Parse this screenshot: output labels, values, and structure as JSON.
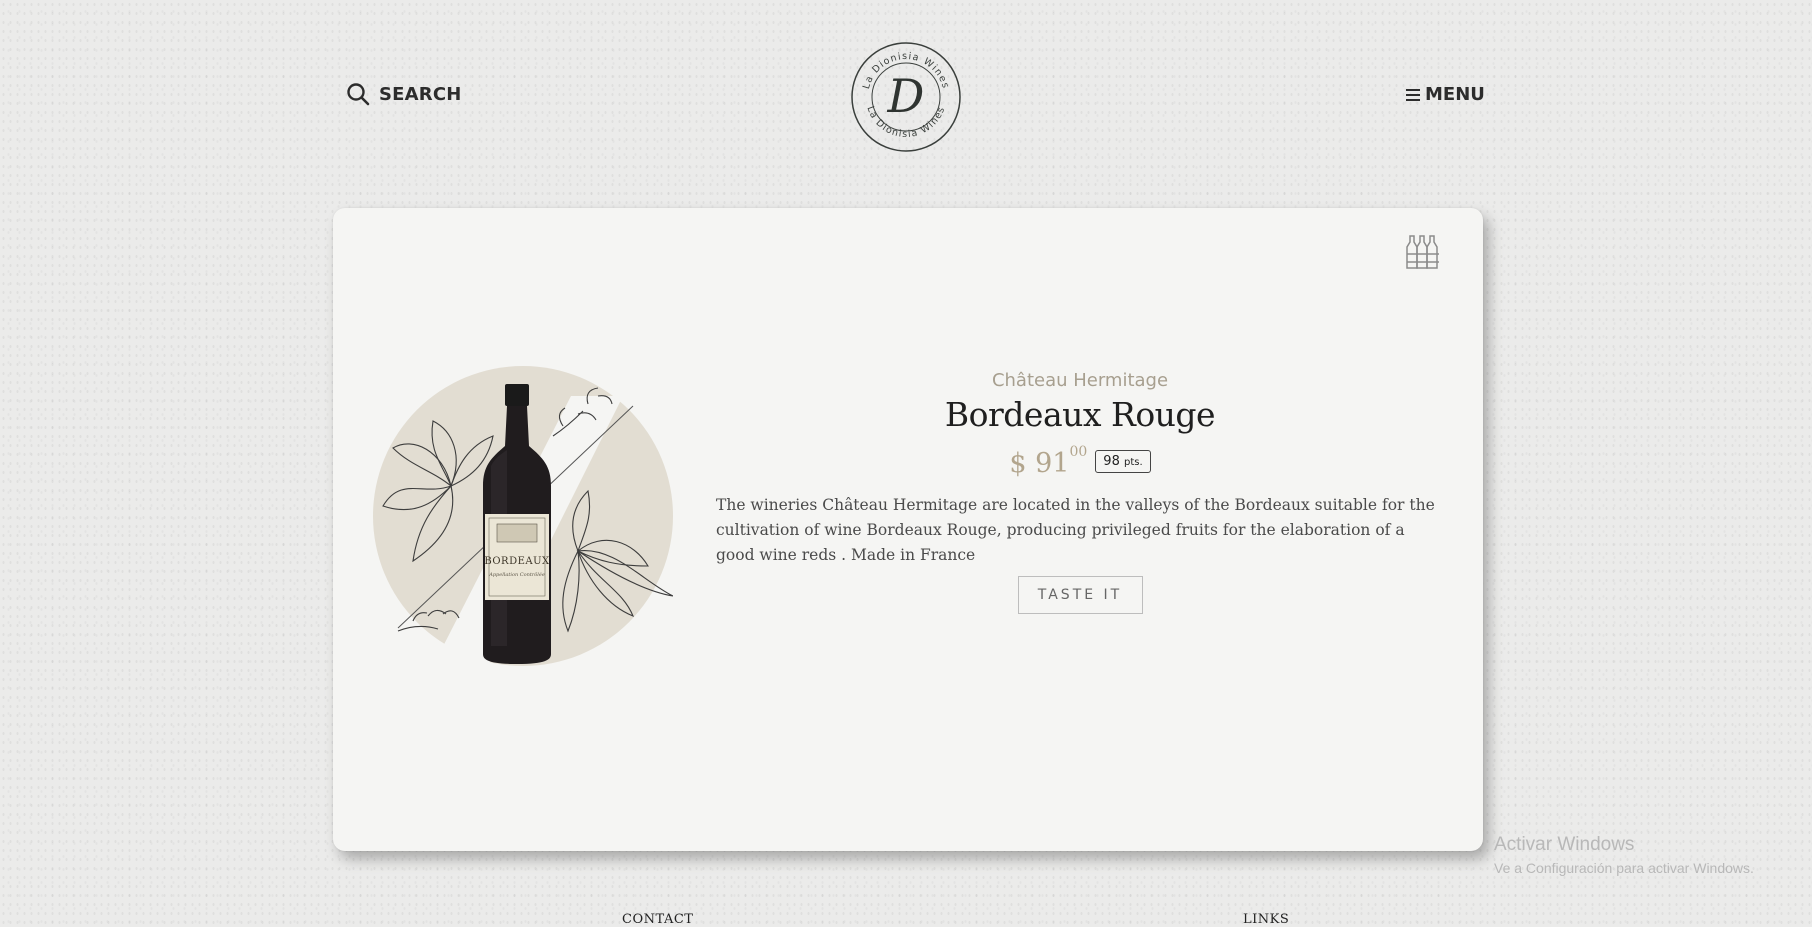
{
  "header": {
    "search_label": "SEARCH",
    "menu_label": "MENU",
    "logo_initial": "D",
    "logo_ring_text": "La Dionisia Wines"
  },
  "product": {
    "winery": "Château Hermitage",
    "name": "Bordeaux Rouge",
    "price_currency": "$",
    "price_whole": "91",
    "price_cents": "00",
    "points": "98",
    "points_unit": "pts.",
    "description": "The wineries Château Hermitage are located in the valleys of the Bordeaux suitable for the cultivation of wine Bordeaux Rouge, producing privileged fruits for the elaboration of a good wine reds . Made in France",
    "cta_label": "TASTE IT",
    "label_text": "BORDEAUX",
    "label_subtext": "Appellation Contrôlée"
  },
  "footer": {
    "col1_heading": "CONTACT",
    "col2_heading": "LINKS"
  },
  "os_watermark": {
    "line1": "Activar Windows",
    "line2": "Ve a Configuración para activar Windows."
  },
  "colors": {
    "accent_gold": "#b2a58d",
    "winery_text": "#a79f8f",
    "text_dark": "#1f1f1f",
    "card_bg": "#f5f5f3",
    "page_bg": "#ebebea"
  },
  "icons": [
    "search-icon",
    "hamburger-icon",
    "wine-compare-icon",
    "logo-emblem"
  ]
}
